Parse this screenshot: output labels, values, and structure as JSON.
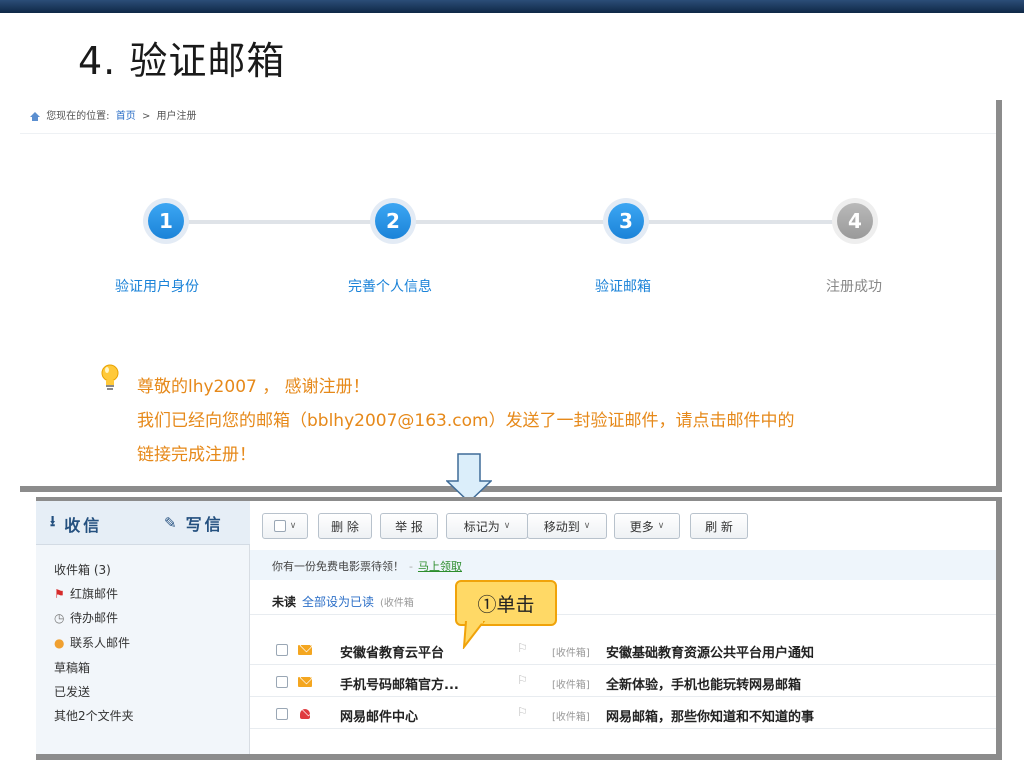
{
  "slide": {
    "title": "4. 验证邮箱"
  },
  "breadcrumb": {
    "prefix": "您现在的位置:",
    "home": "首页",
    "separator": ">",
    "current": "用户注册"
  },
  "steps": [
    {
      "number": "1",
      "label": "验证用户身份",
      "active": true
    },
    {
      "number": "2",
      "label": "完善个人信息",
      "active": true
    },
    {
      "number": "3",
      "label": "验证邮箱",
      "active": true
    },
    {
      "number": "4",
      "label": "注册成功",
      "active": false
    }
  ],
  "message": {
    "line1": "尊敬的lhy2007 ， 感谢注册！",
    "line2": "我们已经向您的邮箱（bblhy2007@163.com）发送了一封验证邮件，请点击邮件中的",
    "line3": "链接完成注册！"
  },
  "mail": {
    "receive_label": "收信",
    "compose_label": "写信",
    "folders": [
      {
        "label": "收件箱 (3)",
        "icon": ""
      },
      {
        "label": "红旗邮件",
        "icon": "red-flag-icon"
      },
      {
        "label": "待办邮件",
        "icon": "clock-icon"
      },
      {
        "label": "联系人邮件",
        "icon": "contact-icon"
      },
      {
        "label": "草稿箱",
        "icon": ""
      },
      {
        "label": "已发送",
        "icon": ""
      },
      {
        "label": "其他2个文件夹",
        "icon": ""
      }
    ],
    "toolbar": {
      "delete": "删 除",
      "report": "举 报",
      "mark_as": "标记为",
      "move_to": "移动到",
      "more": "更多",
      "refresh": "刷 新"
    },
    "notice": {
      "text": "你有一份免费电影票待领！",
      "link": "马上领取"
    },
    "unread": {
      "label": "未读",
      "mark_all": "全部设为已读",
      "hint": "(收件箱"
    },
    "rows": [
      {
        "sender": "安徽省教育云平台",
        "folder": "[收件箱]",
        "subject": "安徽基础教育资源公共平台用户通知"
      },
      {
        "sender": "手机号码邮箱官方...",
        "folder": "[收件箱]",
        "subject": "全新体验，手机也能玩转网易邮箱"
      },
      {
        "sender": "网易邮件中心",
        "folder": "[收件箱]",
        "subject": "网易邮箱，那些你知道和不知道的事"
      }
    ]
  },
  "callout": {
    "text": "①单击"
  },
  "colors": {
    "accent": "#1b83d8",
    "message": "#e6891a",
    "callout": "#ffd966"
  }
}
